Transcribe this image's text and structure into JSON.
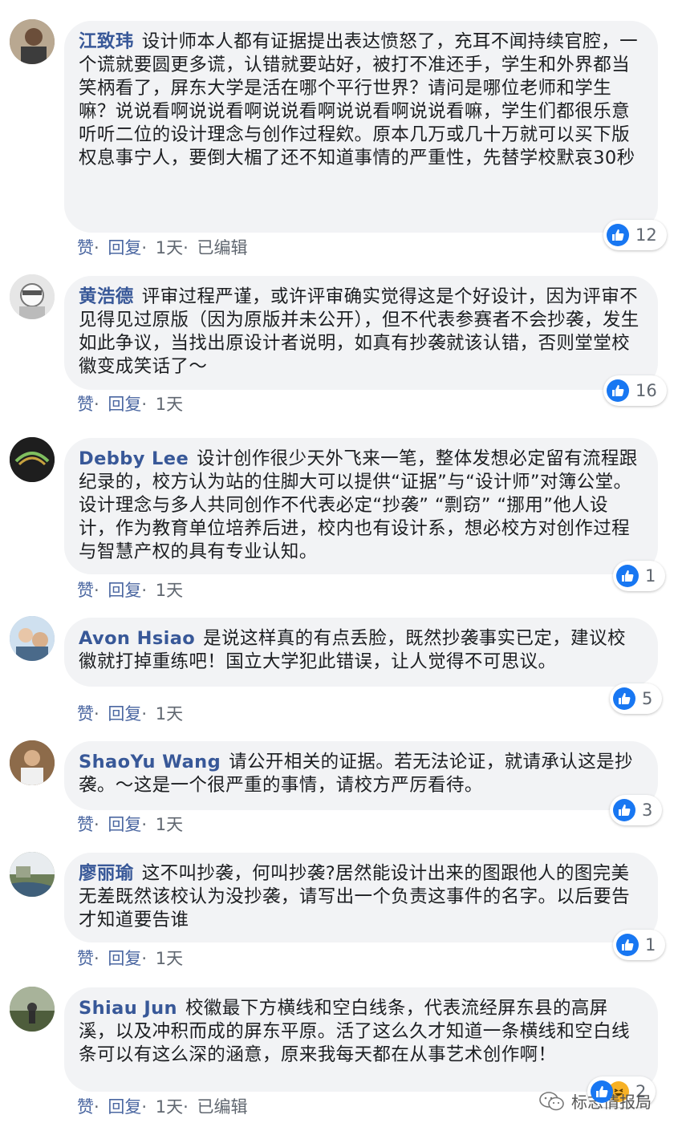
{
  "comments": [
    {
      "author": "江致玮",
      "text": "设计师本人都有证据提出表达愤怒了，充耳不闻持续官腔，一个谎就要圆更多谎，认错就要站好，被打不准还手，学生和外界都当笑柄看了，屏东大学是活在哪个平行世界？请问是哪位老师和学生嘛？说说看啊说说看啊说说看啊说说看啊说说看嘛，学生们都很乐意听听二位的设计理念与创作过程欸。原本几万或几十万就可以买下版权息事宁人，要倒大楣了还不知道事情的严重性，先替学校默哀30秒",
      "like": "赞",
      "reply": "回复",
      "time": "1天",
      "edited": "已编辑",
      "reactions": "12",
      "avatar_color": "#8a7a6a"
    },
    {
      "author": "黄浩德",
      "text": "评审过程严谨，或许评审确实觉得这是个好设计，因为评审不见得见过原版（因为原版并未公开），但不代表参赛者不会抄袭，发生如此争议，当找出原设计者说明，如真有抄袭就该认错，否则堂堂校徽变成笑话了～",
      "like": "赞",
      "reply": "回复",
      "time": "1天",
      "reactions": "16",
      "avatar_color": "#d8d8d8"
    },
    {
      "author": "Debby Lee",
      "text": "设计创作很少天外飞来一笔，整体发想必定留有流程跟纪录的，校方认为站的住脚大可以提供“证据”与“设计师”对簿公堂。设计理念与多人共同创作不代表必定“抄袭” “剽窃” “挪用”他人设计，作为教育单位培养后进，校内也有设计系，想必校方对创作过程与智慧产权的具有专业认知。",
      "like": "赞",
      "reply": "回复",
      "time": "1天",
      "reactions": "1",
      "avatar_color": "#2a2a2a"
    },
    {
      "author": "Avon Hsiao",
      "text": "是说这样真的有点丢脸，既然抄袭事实已定，建议校徽就打掉重练吧！国立大学犯此错误，让人觉得不可思议。",
      "like": "赞",
      "reply": "回复",
      "time": "1天",
      "reactions": "5",
      "avatar_color": "#9bb3c9"
    },
    {
      "author": "ShaoYu Wang",
      "text": "请公开相关的证据。若无法论证，就请承认这是抄袭。～这是一个很严重的事情，请校方严厉看待。",
      "like": "赞",
      "reply": "回复",
      "time": "1天",
      "reactions": "3",
      "avatar_color": "#7a5a3a"
    },
    {
      "author": "廖丽瑜",
      "text": "这不叫抄袭，何叫抄袭?居然能设计出来的图跟他人的图完美无差既然该校认为没抄袭，请写出一个负责这事件的名字。以后要告才知道要告谁",
      "like": "赞",
      "reply": "回复",
      "time": "1天",
      "reactions": "1",
      "avatar_color": "#5d6b4e"
    },
    {
      "author": "Shiau Jun",
      "text": "校徽最下方横线和空白线条，代表流经屏东县的高屏溪，以及冲积而成的屏东平原。活了这么久才知道一条横线和空白线条可以有这么深的涵意，原来我每天都在从事艺术创作啊！",
      "like": "赞",
      "reply": "回复",
      "time": "1天",
      "edited": "已编辑",
      "reactions": "2",
      "avatar_color": "#6b7a58"
    }
  ],
  "watermark": "标志情报局",
  "colors": {
    "author": "#385898",
    "action_link": "#4b67a1",
    "bubble": "#f2f3f5",
    "like_blue": "#1877f2",
    "haha_yellow": "#f7b125"
  }
}
